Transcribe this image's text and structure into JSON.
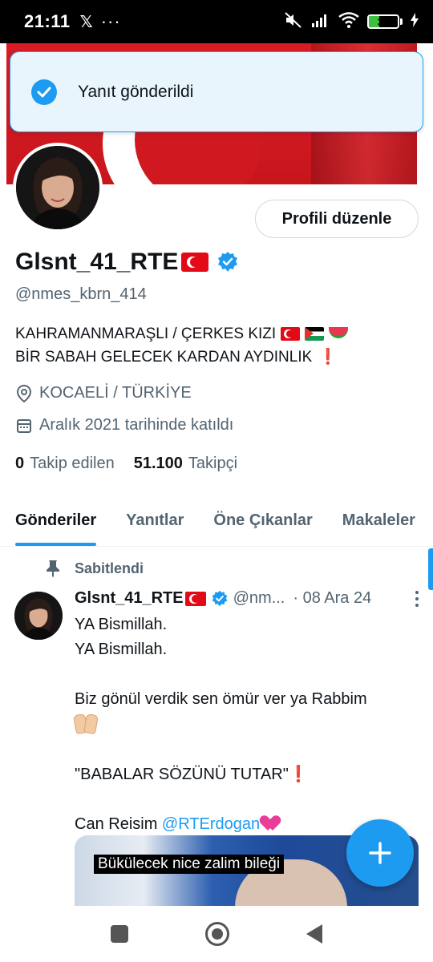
{
  "status_bar": {
    "time": "21:11",
    "x_glyph": "𝕏",
    "more_glyph": "···",
    "battery": "36",
    "battery_level": 0.36
  },
  "toast": {
    "message": "Yanıt gönderildi"
  },
  "profile": {
    "edit_button": "Profili düzenle",
    "display_name": "Glsnt_41_RTE",
    "handle": "@nmes_kbrn_414",
    "bio_line1": "KAHRAMANMARAŞLI / ÇERKES KIZI",
    "bio_line2": "BİR SABAH GELECEK KARDAN AYDINLIK",
    "bio_exclaim": "❗",
    "location": "KOCAELİ / TÜRKİYE",
    "joined": "Aralık 2021 tarihinde katıldı",
    "following_count": "0",
    "following_label": "Takip edilen",
    "followers_count": "51.100",
    "followers_label": "Takipçi"
  },
  "tabs": [
    {
      "label": "Gönderiler"
    },
    {
      "label": "Yanıtlar"
    },
    {
      "label": "Öne Çıkanlar"
    },
    {
      "label": "Makaleler"
    }
  ],
  "pinned_post": {
    "pinned_label": "Sabitlendi",
    "author_name": "Glsnt_41_RTE",
    "author_handle": "@nm...",
    "date": "· 08 Ara 24",
    "lines": {
      "l1": "YA Bismillah.",
      "l2": "YA Bismillah.",
      "l3": "Biz gönül verdik sen ömür ver ya Rabbim",
      "l4": "\"BABALAR SÖZÜNÜ TUTAR\"",
      "l4_exclaim": "❗",
      "l5_prefix": "Can Reisim ",
      "l5_mention": "@RTErdogan"
    },
    "media_caption": "Bükülecek nice zalim bileği"
  },
  "colors": {
    "accent": "#1d9bf0",
    "text_primary": "#0f1419",
    "text_secondary": "#536471"
  },
  "icons": [
    "check-icon",
    "verified-badge-icon",
    "location-icon",
    "calendar-icon",
    "pin-icon",
    "more-icon",
    "plus-icon",
    "wifi-icon",
    "signal-icon",
    "mute-icon"
  ]
}
